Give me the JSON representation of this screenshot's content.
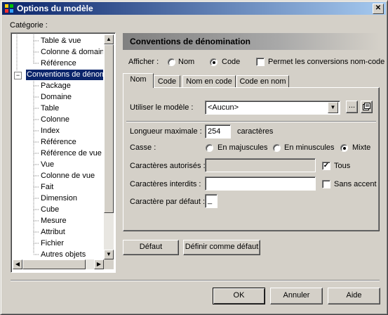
{
  "window": {
    "title": "Options du modèle",
    "close_glyph": "✕"
  },
  "category": {
    "label": "Catégorie :",
    "items": [
      "Table & vue",
      "Colonne & domaine",
      "Référence",
      "Conventions de dénom",
      "Package",
      "Domaine",
      "Table",
      "Colonne",
      "Index",
      "Référence",
      "Référence de vue",
      "Vue",
      "Colonne de vue",
      "Fait",
      "Dimension",
      "Cube",
      "Mesure",
      "Attribut",
      "Fichier",
      "Autres objets"
    ],
    "expand_glyph": "−"
  },
  "panel": {
    "title": "Conventions de dénomination"
  },
  "afficher": {
    "label": "Afficher :",
    "options": [
      "Nom",
      "Code"
    ],
    "selected": "Code",
    "permit_label": "Permet les conversions nom-code",
    "permit_checked": false
  },
  "tabs": [
    "Nom",
    "Code",
    "Nom en code",
    "Code en nom"
  ],
  "active_tab": "Nom",
  "form": {
    "model_label": "Utiliser le modèle :",
    "model_value": "<Aucun>",
    "maxlen_label": "Longueur maximale :",
    "maxlen_value": "254",
    "maxlen_unit": "caractères",
    "case_label": "Casse :",
    "case_options": [
      "En majuscules",
      "En minuscules",
      "Mixte"
    ],
    "case_selected": "Mixte",
    "allowed_label": "Caractères autorisés :",
    "allowed_value": "",
    "all_label": "Tous",
    "all_checked": true,
    "forbidden_label": "Caractères interdits :",
    "forbidden_value": "",
    "no_accent_label": "Sans accent",
    "no_accent_checked": false,
    "default_char_label": "Caractère par défaut :",
    "default_char_value": "_"
  },
  "buttons": {
    "default": "Défaut",
    "set_default": "Définir comme défaut",
    "ok": "OK",
    "cancel": "Annuler",
    "help": "Aide",
    "ellipsis": "..."
  }
}
